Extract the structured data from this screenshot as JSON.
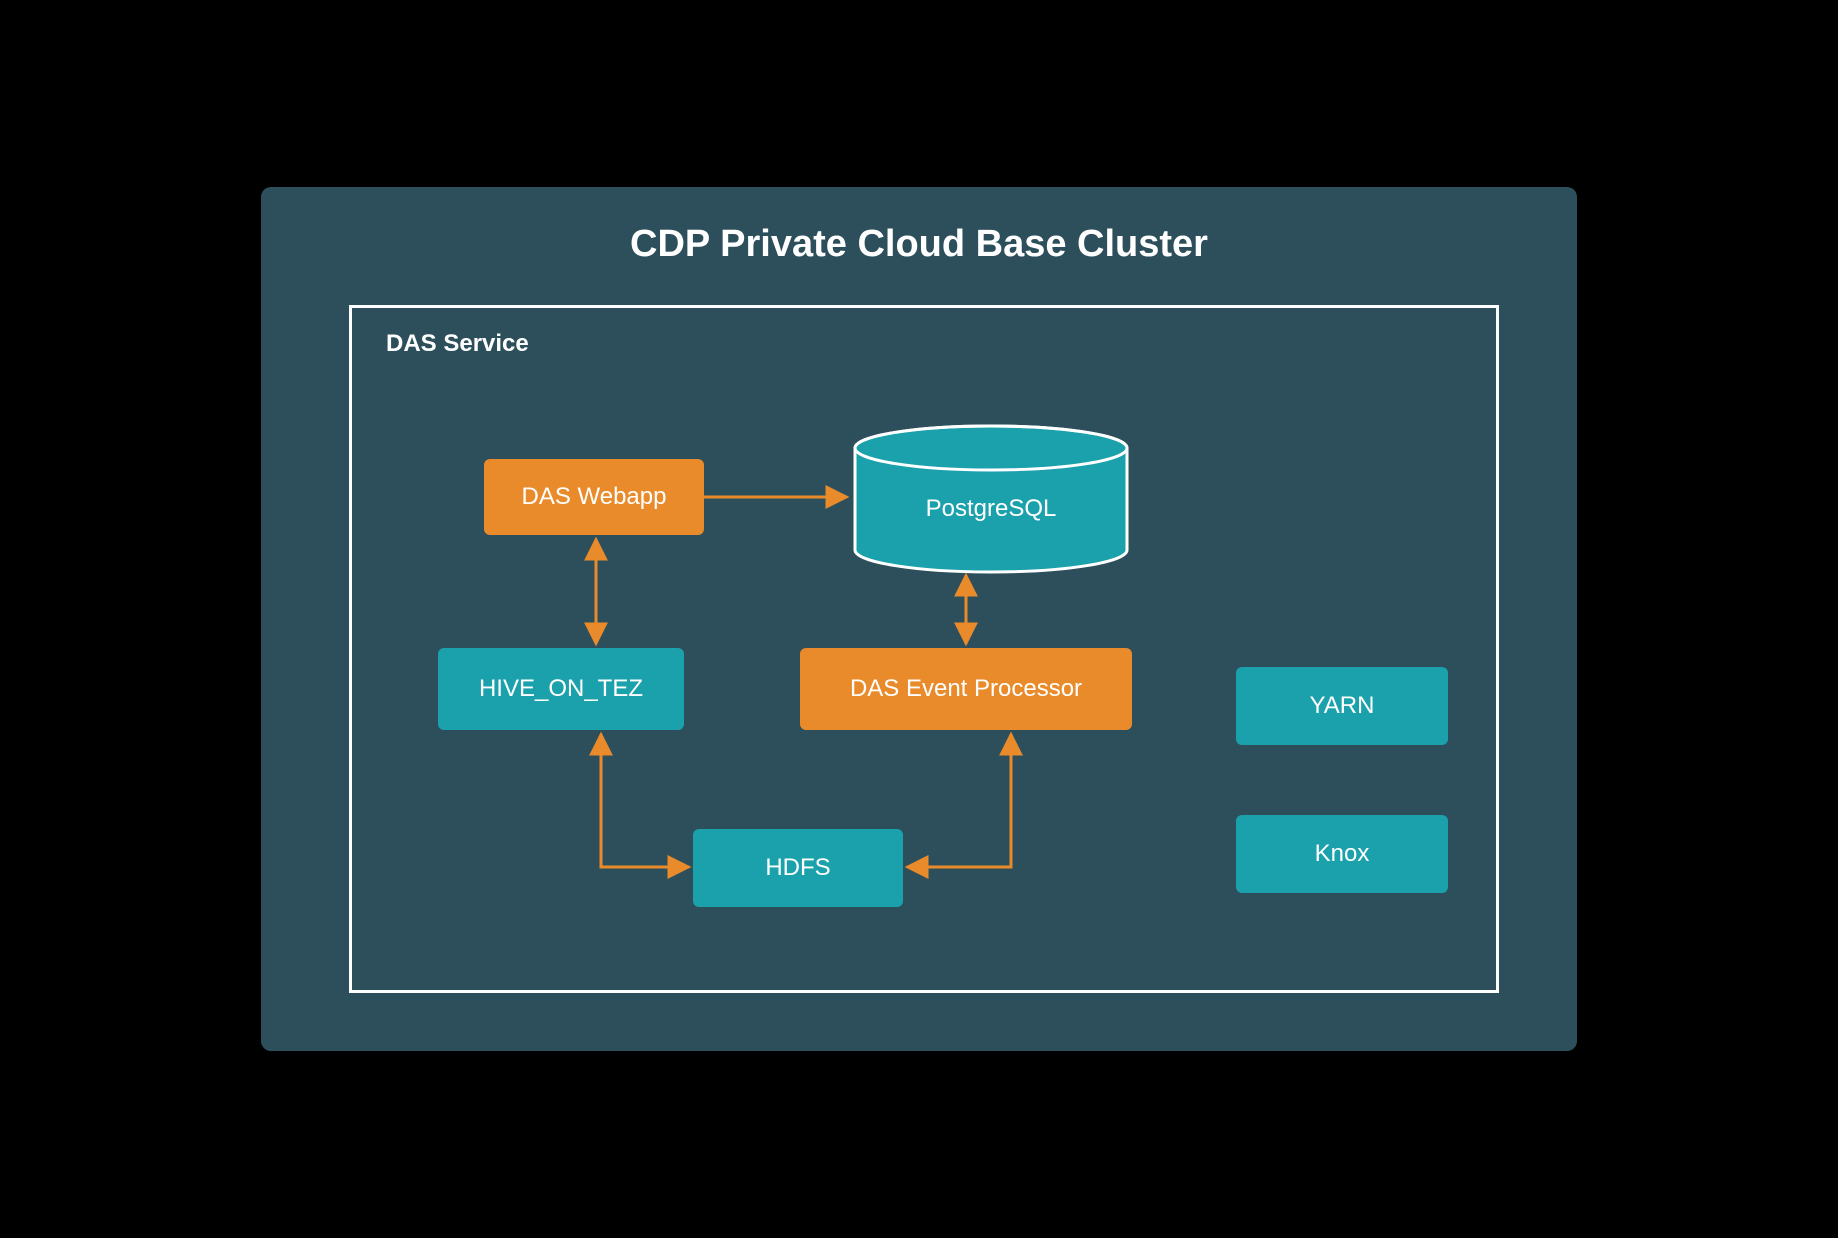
{
  "title": "CDP Private Cloud Base Cluster",
  "service_label": "DAS Service",
  "nodes": {
    "das_webapp": "DAS Webapp",
    "postgres": "PostgreSQL",
    "hive": "HIVE_ON_TEZ",
    "das_ep": "DAS Event Processor",
    "hdfs": "HDFS",
    "yarn": "YARN",
    "knox": "Knox"
  },
  "colors": {
    "background": "#2d4f5c",
    "orange": "#e98b2a",
    "teal": "#1ba1ac",
    "connector": "#e98b2a"
  },
  "connections": [
    {
      "from": "das_webapp",
      "to": "postgres",
      "type": "uni"
    },
    {
      "from": "das_webapp",
      "to": "hive",
      "type": "bi"
    },
    {
      "from": "das_ep",
      "to": "postgres",
      "type": "bi"
    },
    {
      "from": "hive",
      "to": "hdfs",
      "type": "elbow-left"
    },
    {
      "from": "das_ep",
      "to": "hdfs",
      "type": "elbow-right"
    }
  ]
}
